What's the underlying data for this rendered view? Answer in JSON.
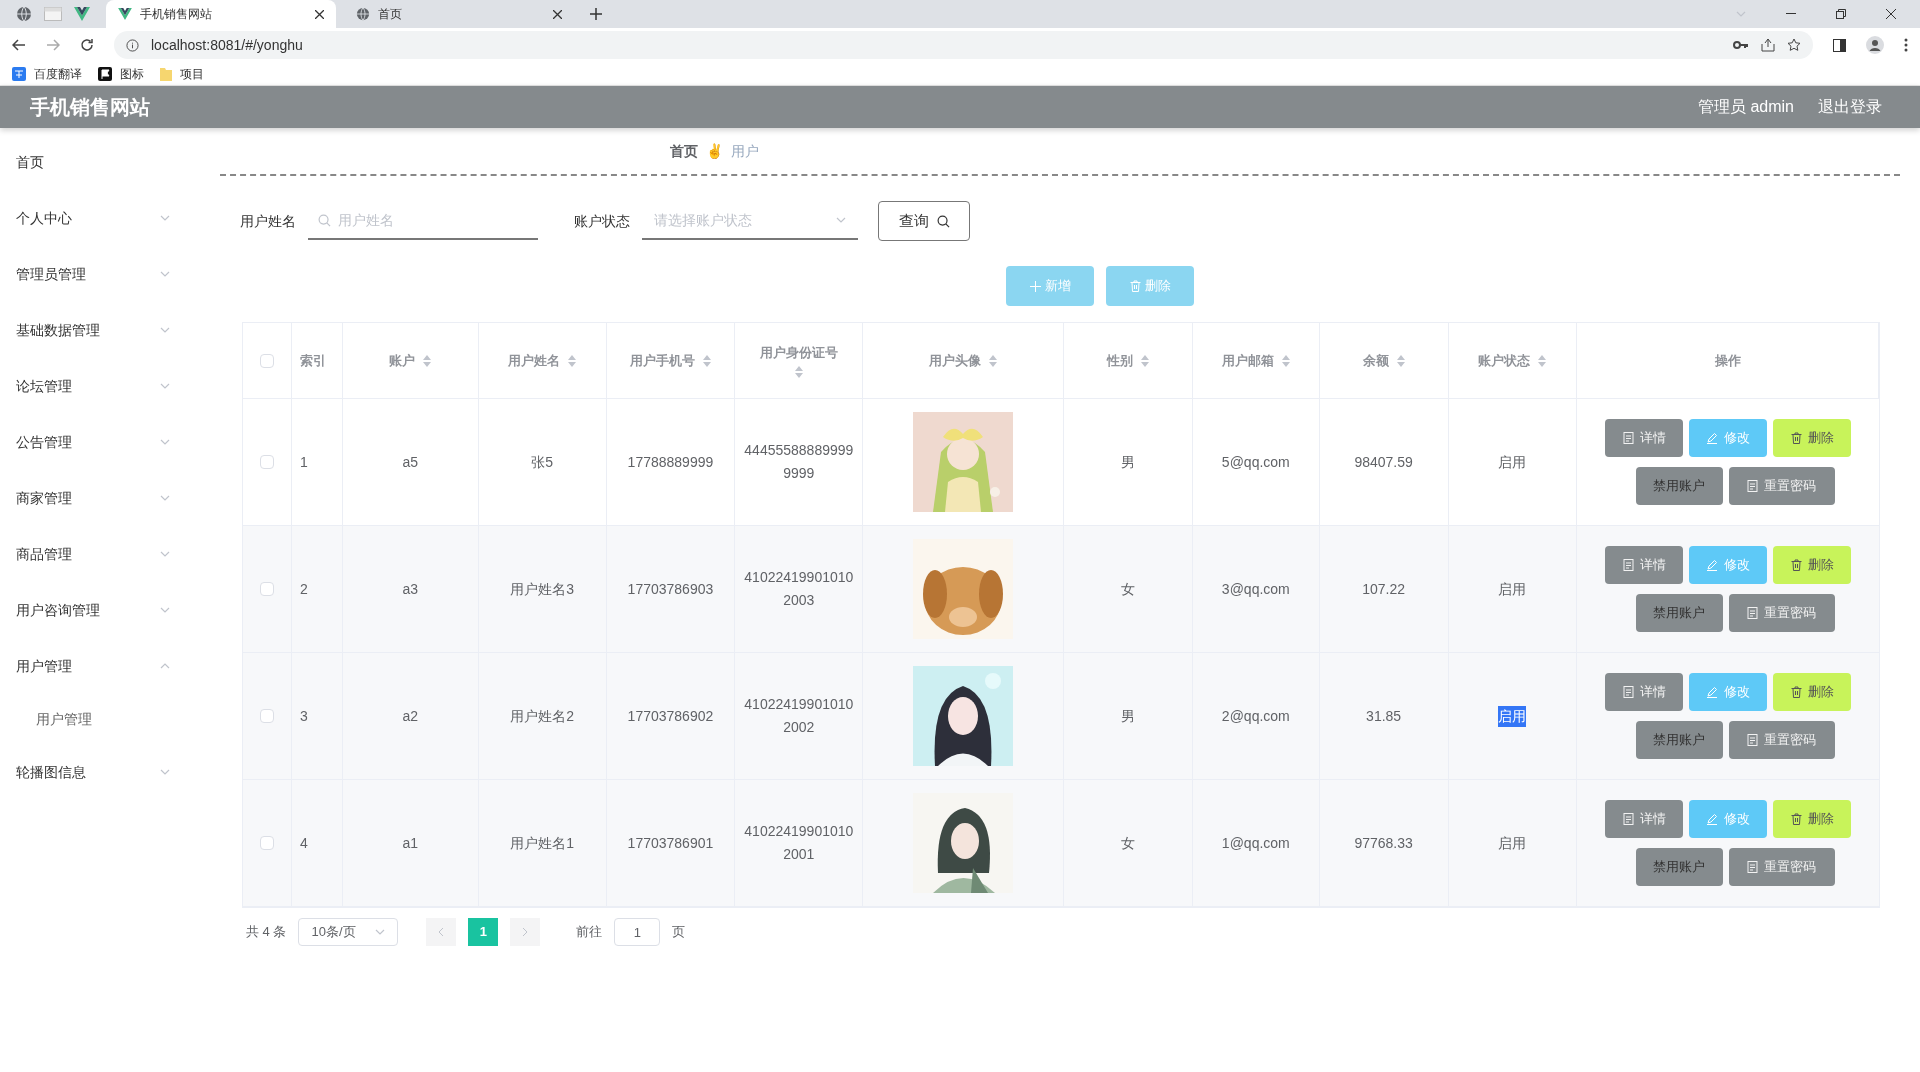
{
  "browser": {
    "tabs": [
      {
        "title": "手机销售网站",
        "selected": true
      },
      {
        "title": "首页",
        "selected": false
      }
    ],
    "url": "localhost:8081/#/yonghu",
    "bookmarks": [
      {
        "label": "百度翻译"
      },
      {
        "label": "图标"
      },
      {
        "label": "项目"
      }
    ]
  },
  "header": {
    "title": "手机销售网站",
    "user": "管理员 admin",
    "logout": "退出登录"
  },
  "sidebar": {
    "items": [
      {
        "label": "首页"
      },
      {
        "label": "个人中心",
        "expandable": true,
        "expanded": false
      },
      {
        "label": "管理员管理",
        "expandable": true,
        "expanded": false
      },
      {
        "label": "基础数据管理",
        "expandable": true,
        "expanded": false
      },
      {
        "label": "论坛管理",
        "expandable": true,
        "expanded": false
      },
      {
        "label": "公告管理",
        "expandable": true,
        "expanded": false
      },
      {
        "label": "商家管理",
        "expandable": true,
        "expanded": false
      },
      {
        "label": "商品管理",
        "expandable": true,
        "expanded": false
      },
      {
        "label": "用户咨询管理",
        "expandable": true,
        "expanded": false
      },
      {
        "label": "用户管理",
        "expandable": true,
        "expanded": true,
        "children": [
          {
            "label": "用户管理"
          }
        ]
      },
      {
        "label": "轮播图信息",
        "expandable": true,
        "expanded": false
      }
    ]
  },
  "breadcrumb": {
    "items": [
      "首页",
      "用户"
    ],
    "separator": "✌"
  },
  "search": {
    "name_label": "用户姓名",
    "name_placeholder": "用户姓名",
    "status_label": "账户状态",
    "status_placeholder": "请选择账户状态",
    "query_button": "查询"
  },
  "actions": [
    {
      "label": "新增",
      "kind": "add"
    },
    {
      "label": "删除",
      "kind": "delete"
    }
  ],
  "table": {
    "columns": [
      {
        "label": "索引",
        "sortable": false
      },
      {
        "label": "账户",
        "sortable": true
      },
      {
        "label": "用户姓名",
        "sortable": true
      },
      {
        "label": "用户手机号",
        "sortable": true
      },
      {
        "label": "用户身份证号",
        "sortable": true
      },
      {
        "label": "用户头像",
        "sortable": true
      },
      {
        "label": "性别",
        "sortable": true
      },
      {
        "label": "用户邮箱",
        "sortable": true
      },
      {
        "label": "余额",
        "sortable": true
      },
      {
        "label": "账户状态",
        "sortable": true
      },
      {
        "label": "操作",
        "sortable": false
      }
    ],
    "select_all_checked": false,
    "rows": [
      {
        "checked": false,
        "status_selected": false,
        "cells": [
          "1",
          "a5",
          "张5",
          "17788889999",
          "444555888899999999",
          "",
          "男",
          "5@qq.com",
          "98407.59",
          "启用"
        ],
        "buttons": [
          {
            "label": "详情",
            "kind": "detail"
          },
          {
            "label": "修改",
            "kind": "edit"
          },
          {
            "label": "删除",
            "kind": "delete"
          },
          {
            "label": "禁用账户",
            "kind": "disable"
          },
          {
            "label": "重置密码",
            "kind": "reset"
          }
        ]
      },
      {
        "checked": false,
        "status_selected": false,
        "cells": [
          "2",
          "a3",
          "用户姓名3",
          "17703786903",
          "410224199010102003",
          "",
          "女",
          "3@qq.com",
          "107.22",
          "启用"
        ],
        "buttons": [
          {
            "label": "详情",
            "kind": "detail"
          },
          {
            "label": "修改",
            "kind": "edit"
          },
          {
            "label": "删除",
            "kind": "delete"
          },
          {
            "label": "禁用账户",
            "kind": "disable"
          },
          {
            "label": "重置密码",
            "kind": "reset"
          }
        ]
      },
      {
        "checked": false,
        "status_selected": true,
        "cells": [
          "3",
          "a2",
          "用户姓名2",
          "17703786902",
          "410224199010102002",
          "",
          "男",
          "2@qq.com",
          "31.85",
          "启用"
        ],
        "buttons": [
          {
            "label": "详情",
            "kind": "detail"
          },
          {
            "label": "修改",
            "kind": "edit"
          },
          {
            "label": "删除",
            "kind": "delete"
          },
          {
            "label": "禁用账户",
            "kind": "disable"
          },
          {
            "label": "重置密码",
            "kind": "reset"
          }
        ]
      },
      {
        "checked": false,
        "status_selected": false,
        "cells": [
          "4",
          "a1",
          "用户姓名1",
          "17703786901",
          "410224199010102001",
          "",
          "女",
          "1@qq.com",
          "97768.33",
          "启用"
        ],
        "buttons": [
          {
            "label": "详情",
            "kind": "detail"
          },
          {
            "label": "修改",
            "kind": "edit"
          },
          {
            "label": "删除",
            "kind": "delete"
          },
          {
            "label": "禁用账户",
            "kind": "disable"
          },
          {
            "label": "重置密码",
            "kind": "reset"
          }
        ]
      }
    ]
  },
  "pagination": {
    "total": "共 4 条",
    "page_size": "10条/页",
    "pages": [
      {
        "label": "1",
        "selected": true
      }
    ],
    "goto_label": "前往",
    "goto_value": "1",
    "page_unit": "页"
  }
}
